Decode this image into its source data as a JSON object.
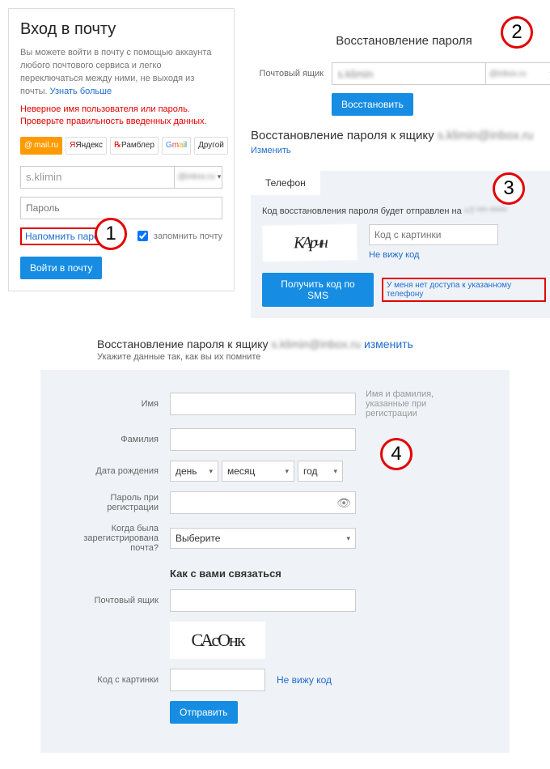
{
  "login": {
    "title": "Вход в почту",
    "desc_prefix": "Вы можете войти в почту с помощью аккаунта любого почтового сервиса и легко переключаться между ними, не выходя из почты. ",
    "learn_more": "Узнать больше",
    "error": "Неверное имя пользователя или пароль. Проверьте правильность введенных данных.",
    "providers": {
      "mailru": "mail.ru",
      "yandex": "Яндекс",
      "rambler": "Рамблер",
      "gmail": "Gmail",
      "other": "Другой"
    },
    "email_value": "s.klimin",
    "email_domain": "@inbox.ru",
    "password_placeholder": "Пароль",
    "remind_link": "Напомнить пароль",
    "remember_label": "запомнить почту",
    "remember_checked": true,
    "submit": "Войти в почту"
  },
  "recover1": {
    "title": "Восстановление пароля",
    "field_label": "Почтовый ящик",
    "email_value": "s.klimin",
    "email_domain": "@inbox.ru",
    "submit": "Восстановить"
  },
  "recover2": {
    "title_prefix": "Восстановление пароля к ящику ",
    "title_blur": "s.klimin@inbox.ru",
    "change_link": "Изменить",
    "tab": "Телефон",
    "line_prefix": "Код восстановления пароля будет отправлен на ",
    "line_blur": "+7 *** *****",
    "captcha_text": "КАрчн",
    "captcha_placeholder": "Код с картинки",
    "no_see": "Не вижу код",
    "submit": "Получить код по SMS",
    "no_access": "У меня нет доступа к указанному телефону"
  },
  "recover3": {
    "title_prefix": "Восстановление пароля к ящику ",
    "title_blur": "s.klimin@inbox.ru",
    "change_link": "изменить",
    "subhint": "Укажите данные так, как вы их помните",
    "fields": {
      "first_name": "Имя",
      "last_name": "Фамилия",
      "dob": "Дата рождения",
      "day": "день",
      "month": "месяц",
      "year": "год",
      "reg_password": "Пароль при регистрации",
      "when_registered": "Когда была зарегистрирована почта?",
      "choose": "Выберите",
      "name_hint": "Имя и фамилия, указанные при регистрации",
      "contact_header": "Как с вами связаться",
      "mailbox": "Почтовый ящик",
      "captcha_text": "САсОнк",
      "captcha_label": "Код с картинки",
      "no_see": "Не вижу код",
      "submit": "Отправить"
    }
  },
  "step_numbers": {
    "s1": "1",
    "s2": "2",
    "s3": "3",
    "s4": "4"
  }
}
